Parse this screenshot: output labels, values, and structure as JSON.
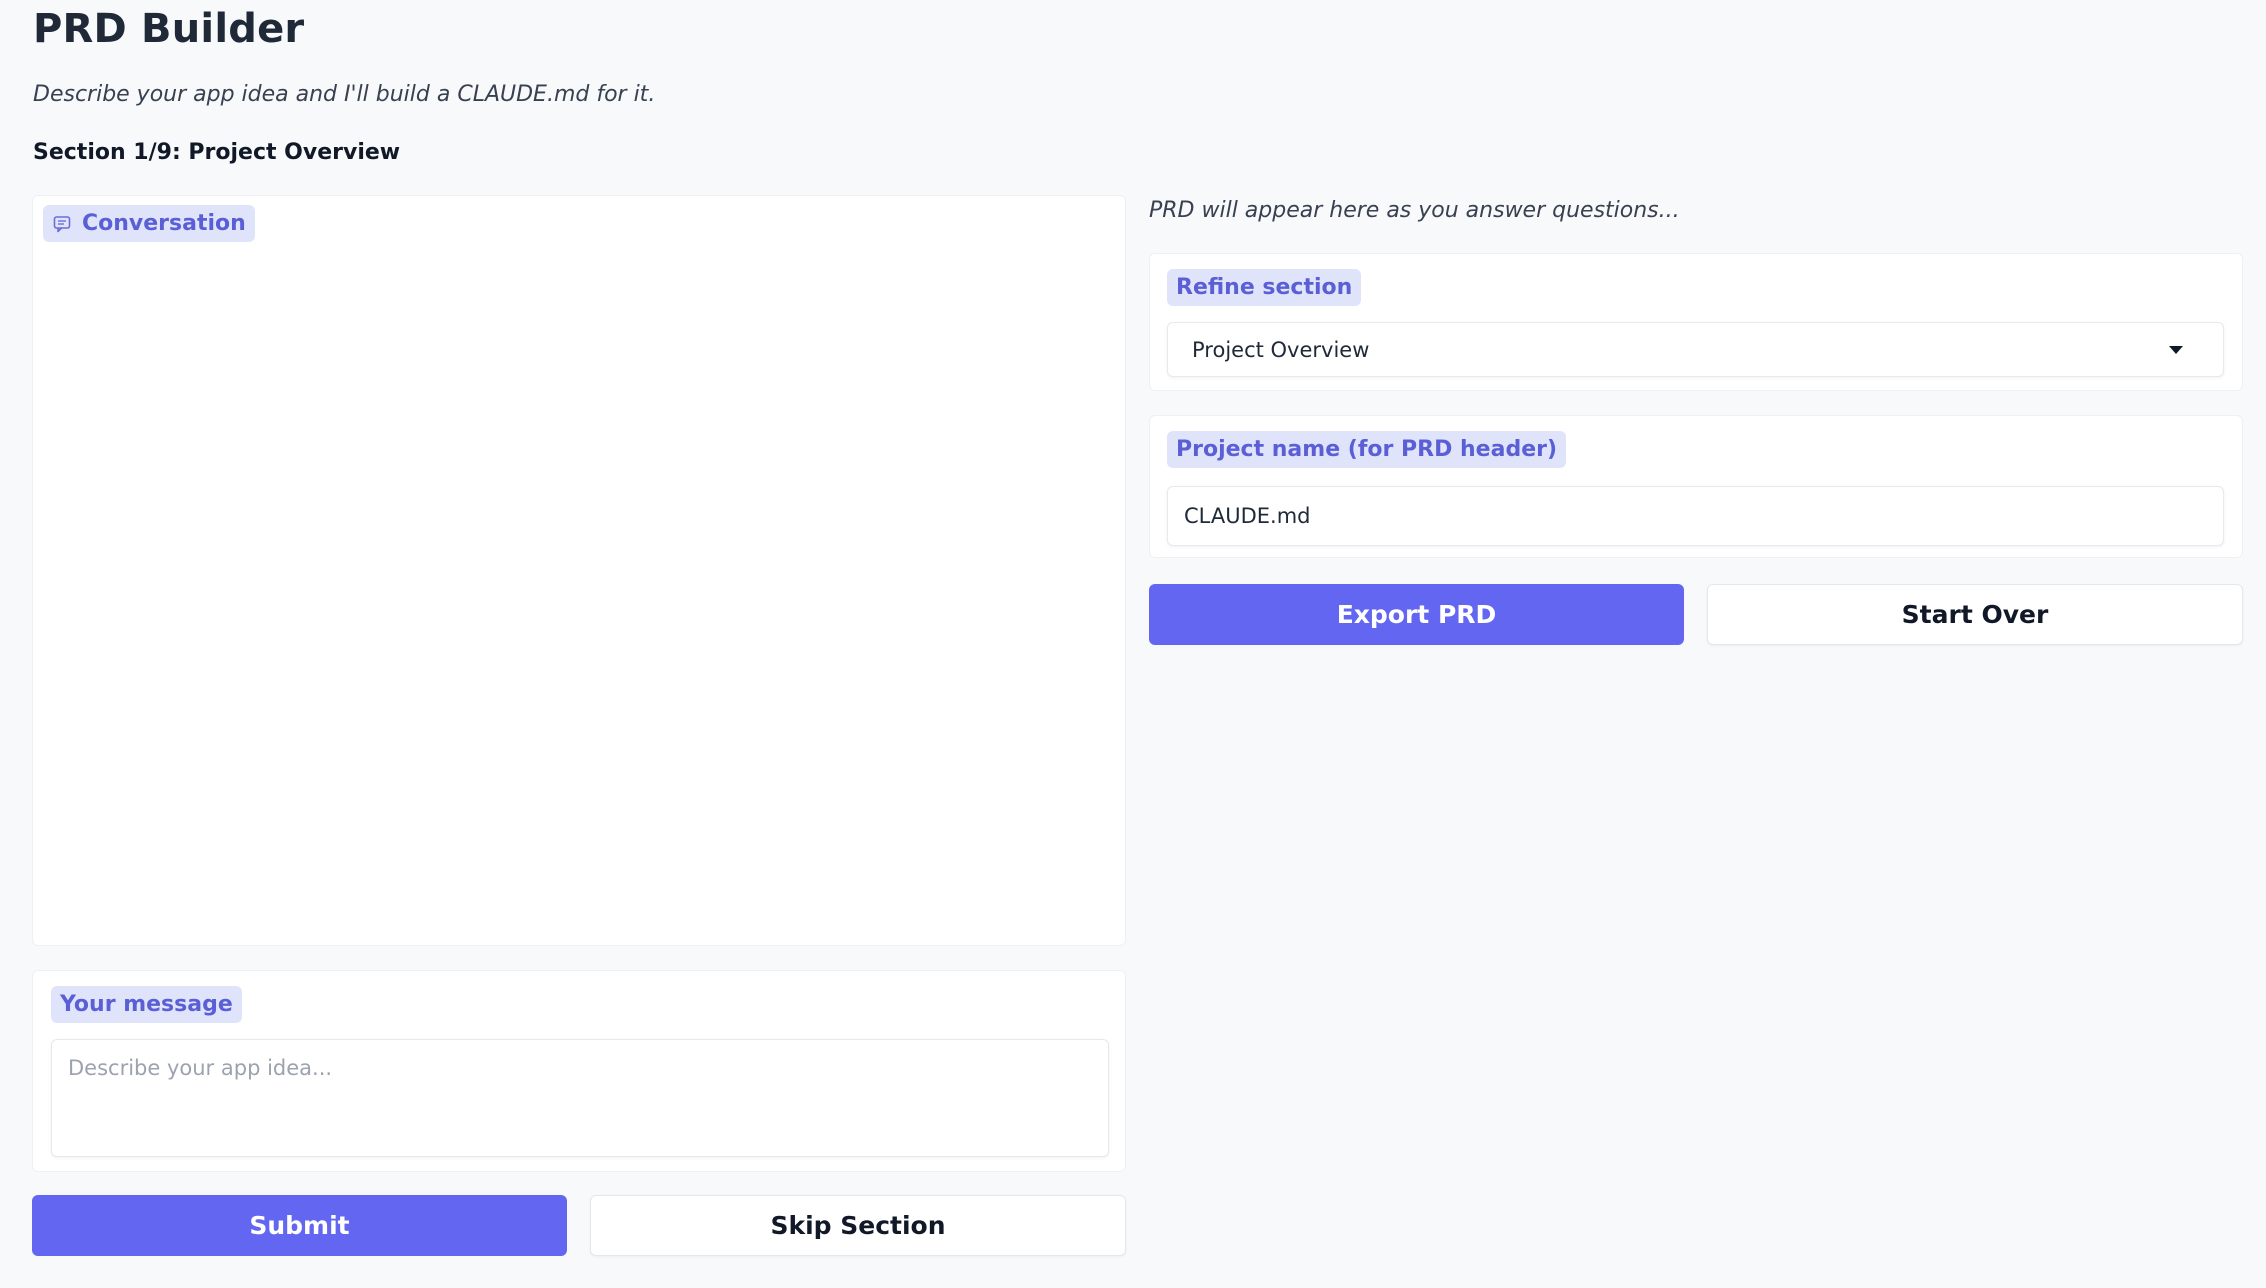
{
  "app": {
    "title": "PRD Builder",
    "subtitle": "Describe your app idea and I'll build a CLAUDE.md for it.",
    "section_heading": "Section 1/9: Project Overview"
  },
  "conversation": {
    "label": "Conversation",
    "icon": "chat-icon"
  },
  "message": {
    "label": "Your message",
    "value": "",
    "placeholder": "Describe your app idea..."
  },
  "actions": {
    "submit_label": "Submit",
    "skip_label": "Skip Section",
    "export_label": "Export PRD",
    "start_over_label": "Start Over"
  },
  "prd": {
    "placeholder": "PRD will appear here as you answer questions..."
  },
  "refine": {
    "label": "Refine section",
    "selected": "Project Overview"
  },
  "project_name": {
    "label": "Project name (for PRD header)",
    "value": "CLAUDE.md"
  },
  "colors": {
    "accent": "#6366f1",
    "chip_bg": "#e0e4fb",
    "chip_text": "#5b5fd6",
    "page_bg": "#f8f9fb"
  }
}
